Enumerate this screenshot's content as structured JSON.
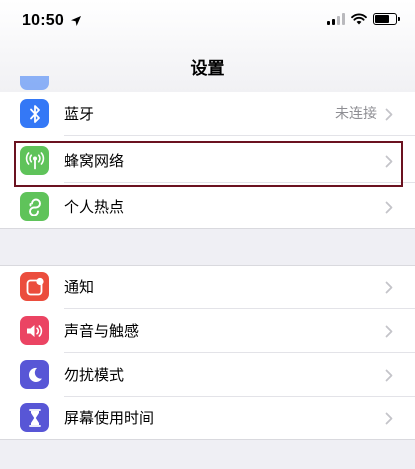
{
  "status_bar": {
    "time": "10:50"
  },
  "nav": {
    "title": "设置"
  },
  "groups": [
    {
      "rows": [
        {
          "label": "蓝牙",
          "value": "未连接",
          "icon": "bluetooth-icon",
          "icon_color": "#3478f6"
        },
        {
          "label": "蜂窝网络",
          "value": "",
          "icon": "cellular-icon",
          "icon_color": "#5fc35a",
          "highlighted": true
        },
        {
          "label": "个人热点",
          "value": "",
          "icon": "hotspot-icon",
          "icon_color": "#5fc35a"
        }
      ]
    },
    {
      "rows": [
        {
          "label": "通知",
          "value": "",
          "icon": "notifications-icon",
          "icon_color": "#eb4d3d"
        },
        {
          "label": "声音与触感",
          "value": "",
          "icon": "sound-icon",
          "icon_color": "#eb4463"
        },
        {
          "label": "勿扰模式",
          "value": "",
          "icon": "moon-icon",
          "icon_color": "#5856d6"
        },
        {
          "label": "屏幕使用时间",
          "value": "",
          "icon": "hourglass-icon",
          "icon_color": "#5856d6"
        }
      ]
    }
  ],
  "colors": {
    "highlight_border": "#6b1220",
    "background": "#efeff4"
  }
}
